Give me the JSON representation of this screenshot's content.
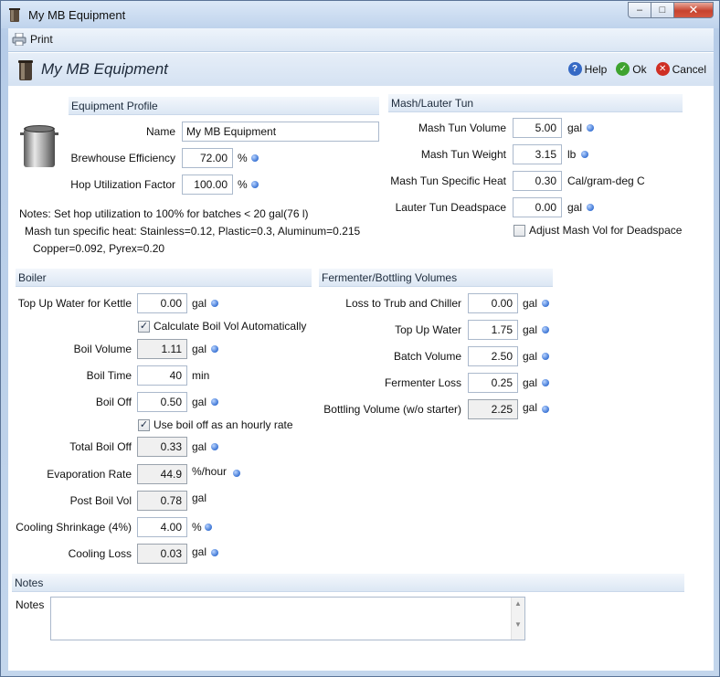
{
  "window": {
    "title": "My MB Equipment",
    "min": "–",
    "max": "□",
    "close": "✕"
  },
  "toolbar": {
    "print_label": "Print"
  },
  "header": {
    "title": "My MB Equipment",
    "help": "Help",
    "ok": "Ok",
    "cancel": "Cancel"
  },
  "equipment_profile": {
    "heading": "Equipment Profile",
    "name_label": "Name",
    "name_value": "My MB Equipment",
    "efficiency_label": "Brewhouse Efficiency",
    "efficiency_value": "72.00",
    "efficiency_unit": "%",
    "hop_label": "Hop Utilization Factor",
    "hop_value": "100.00",
    "hop_unit": "%"
  },
  "notes_text": {
    "line1": "Notes: Set hop utilization to 100% for batches < 20 gal(76 l)",
    "line2": "Mash tun specific heat: Stainless=0.12, Plastic=0.3, Aluminum=0.215",
    "line3": "Copper=0.092, Pyrex=0.20"
  },
  "mash": {
    "heading": "Mash/Lauter Tun",
    "volume_label": "Mash Tun Volume",
    "volume_value": "5.00",
    "volume_unit": "gal",
    "weight_label": "Mash Tun Weight",
    "weight_value": "3.15",
    "weight_unit": "lb",
    "heat_label": "Mash Tun Specific Heat",
    "heat_value": "0.30",
    "heat_unit": "Cal/gram-deg C",
    "deadspace_label": "Lauter Tun Deadspace",
    "deadspace_value": "0.00",
    "deadspace_unit": "gal",
    "adjust_label": "Adjust Mash Vol for Deadspace",
    "adjust_checked": false
  },
  "boiler": {
    "heading": "Boiler",
    "topup_label": "Top Up Water for Kettle",
    "topup_value": "0.00",
    "topup_unit": "gal",
    "calc_label": "Calculate Boil Vol Automatically",
    "calc_checked": true,
    "boilvol_label": "Boil Volume",
    "boilvol_value": "1.11",
    "boilvol_unit": "gal",
    "boiltime_label": "Boil Time",
    "boiltime_value": "40",
    "boiltime_unit": "min",
    "boiloff_label": "Boil Off",
    "boiloff_value": "0.50",
    "boiloff_unit": "gal",
    "hourly_label": "Use boil off as an hourly rate",
    "hourly_checked": true,
    "total_label": "Total Boil Off",
    "total_value": "0.33",
    "total_unit": "gal",
    "evap_label": "Evaporation Rate",
    "evap_value": "44.9",
    "evap_unit": "%/hour",
    "post_label": "Post Boil Vol",
    "post_value": "0.78",
    "post_unit": "gal",
    "shrink_label": "Cooling Shrinkage (4%)",
    "shrink_value": "4.00",
    "shrink_unit": "%",
    "coolloss_label": "Cooling Loss",
    "coolloss_value": "0.03",
    "coolloss_unit": "gal"
  },
  "fermenter": {
    "heading": "Fermenter/Bottling Volumes",
    "trub_label": "Loss to Trub and Chiller",
    "trub_value": "0.00",
    "trub_unit": "gal",
    "topup_label": "Top Up Water",
    "topup_value": "1.75",
    "topup_unit": "gal",
    "batch_label": "Batch Volume",
    "batch_value": "2.50",
    "batch_unit": "gal",
    "loss_label": "Fermenter Loss",
    "loss_value": "0.25",
    "loss_unit": "gal",
    "bottling_label": "Bottling Volume (w/o starter)",
    "bottling_value": "2.25",
    "bottling_unit": "gal"
  },
  "notes": {
    "heading": "Notes",
    "label": "Notes",
    "value": ""
  }
}
